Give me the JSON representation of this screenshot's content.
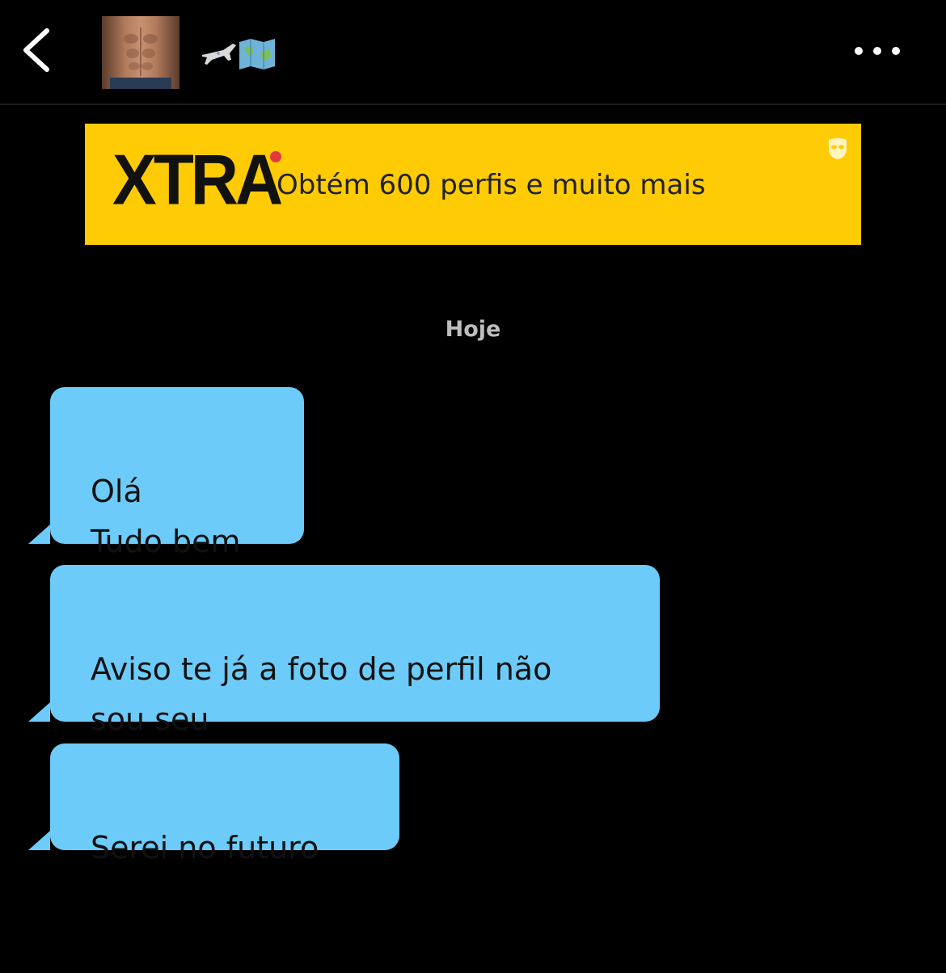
{
  "header": {
    "back_icon": "chevron-left-icon",
    "avatar_alt": "profile photo",
    "status_emojis": [
      "airplane-emoji",
      "map-emoji"
    ],
    "more_icon": "ellipsis-icon"
  },
  "banner": {
    "logo_text": "XTRA",
    "text": "Obtém 600 perfis e muito mais",
    "icon": "mask-icon",
    "background_color": "#FFCB05",
    "dot_color": "#E23A3A"
  },
  "chat": {
    "date_label": "Hoje",
    "bubble_color": "#6CCBF9",
    "messages": [
      {
        "text": "Olá\nTudo bem"
      },
      {
        "text": "Aviso te já a foto de perfil não\nsou seu"
      },
      {
        "text": "Serei no futuro"
      }
    ]
  }
}
